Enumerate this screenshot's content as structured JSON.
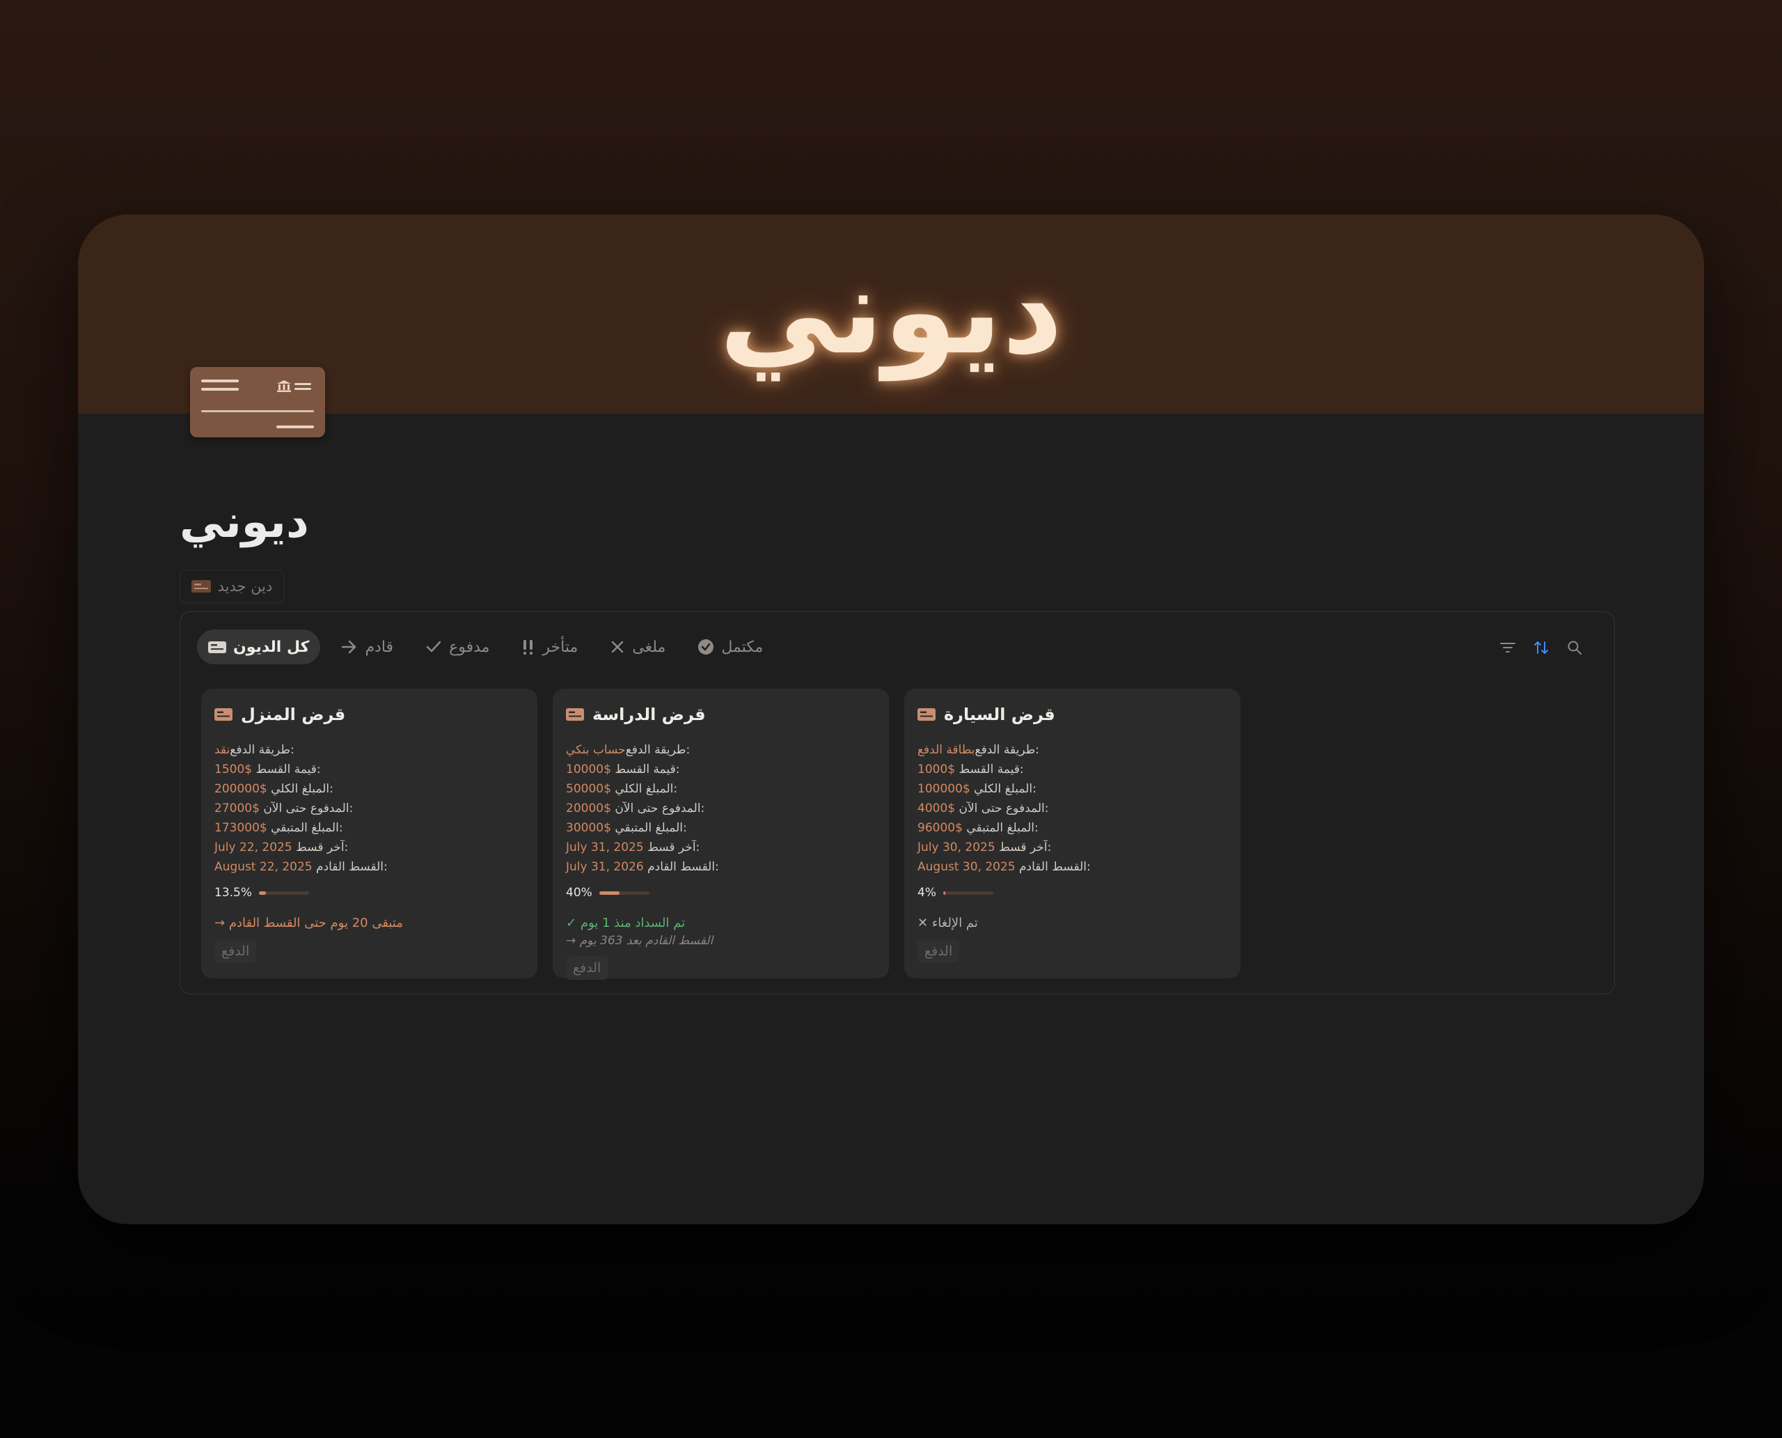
{
  "cover": {
    "title": "ديوني"
  },
  "page": {
    "title": "ديوني",
    "new_button_label": "دين جديد"
  },
  "tabs": [
    {
      "label": "كل الديون",
      "icon": "card-icon",
      "active": true
    },
    {
      "label": "قادم",
      "icon": "arrow-right-icon"
    },
    {
      "label": "مدفوع",
      "icon": "check-icon"
    },
    {
      "label": "متأخر",
      "icon": "double-exclamation-icon"
    },
    {
      "label": "ملغى",
      "icon": "x-icon"
    },
    {
      "label": "مكتمل",
      "icon": "check-circle-icon"
    }
  ],
  "tools": [
    "filter-icon",
    "sort-icon",
    "search-icon"
  ],
  "colors": {
    "accent": "#d38a63",
    "cover": "#3b2519",
    "success": "#5cb373",
    "sort_active": "#3d8bfd"
  },
  "cards": [
    {
      "title": "قرض المنزل",
      "method_label": "طريقة الدفع:",
      "method": "نقد",
      "installment_label": "قيمة القسط:",
      "installment": "1500$",
      "total_label": "المبلغ الكلي:",
      "total": "200000$",
      "paid_label": "المدفوع حتى الآن:",
      "paid": "27000$",
      "remaining_label": "المبلغ المتبقي:",
      "remaining": "173000$",
      "last_label": "آخر قسط:",
      "last": "July 22, 2025",
      "next_label": "القسط القادم:",
      "next": "August 22, 2025",
      "progress_text": "13.5%",
      "progress": 0.135,
      "status": "→ متبقى 20 يوم حتى القسط القادم",
      "status_kind": "orange",
      "substatus": "",
      "pay_label": "الدفع"
    },
    {
      "title": "قرض الدراسة",
      "method_label": "طريقة الدفع:",
      "method": "حساب بنكي",
      "installment_label": "قيمة القسط:",
      "installment": "10000$",
      "total_label": "المبلغ الكلي:",
      "total": "50000$",
      "paid_label": "المدفوع حتى الآن:",
      "paid": "20000$",
      "remaining_label": "المبلغ المتبقي:",
      "remaining": "30000$",
      "last_label": "آخر قسط:",
      "last": "July 31, 2025",
      "next_label": "القسط القادم:",
      "next": "July 31, 2026",
      "progress_text": "40%",
      "progress": 0.4,
      "status": "✓ تم السداد منذ 1 يوم",
      "status_kind": "green",
      "substatus": "→ القسط القادم بعد 363 يوم",
      "pay_label": "الدفع"
    },
    {
      "title": "قرض السيارة",
      "method_label": "طريقة الدفع:",
      "method": "بطاقة الدفع",
      "installment_label": "قيمة القسط:",
      "installment": "1000$",
      "total_label": "المبلغ الكلي:",
      "total": "100000$",
      "paid_label": "المدفوع حتى الآن:",
      "paid": "4000$",
      "remaining_label": "المبلغ المتبقي:",
      "remaining": "96000$",
      "last_label": "آخر قسط:",
      "last": "July 30, 2025",
      "next_label": "القسط القادم:",
      "next": "August 30, 2025",
      "progress_text": "4%",
      "progress": 0.04,
      "status": "✕ تم الإلغاء",
      "status_kind": "gray",
      "substatus": "",
      "pay_label": "الدفع"
    }
  ]
}
